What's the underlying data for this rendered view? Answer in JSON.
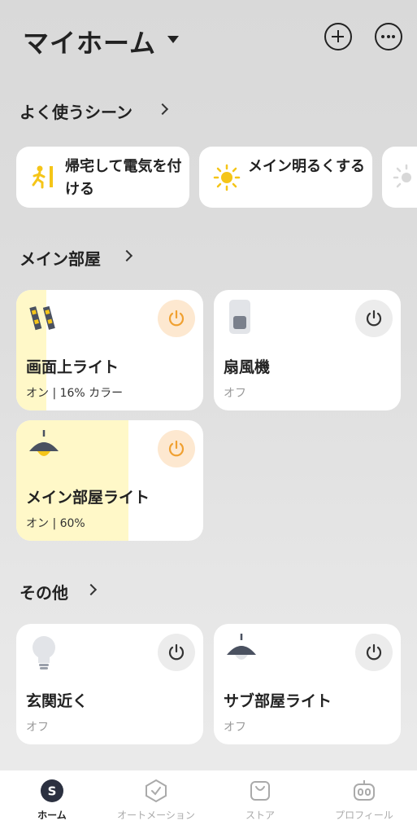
{
  "header": {
    "title": "マイホーム",
    "add_icon": "plus-circle-icon",
    "more_icon": "more-dots-icon"
  },
  "scenes_section": {
    "title": "よく使うシーン",
    "cards": [
      {
        "label": "帰宅して電気を付ける",
        "icon": "person-door-icon"
      },
      {
        "label": "メイン明るくする",
        "icon": "sun-icon"
      },
      {
        "label": "",
        "icon": "sun-icon"
      }
    ]
  },
  "main_room_section": {
    "title": "メイン部屋",
    "devices": [
      {
        "name": "画面上ライト",
        "status": "オン | 16% カラー",
        "power": "on",
        "level_percent": 16,
        "icon": "light-bar-icon"
      },
      {
        "name": "扇風機",
        "status": "オフ",
        "power": "off",
        "icon": "fan-switch-icon"
      },
      {
        "name": "メイン部屋ライト",
        "status": "オン | 60%",
        "power": "on",
        "level_percent": 60,
        "icon": "pendant-lamp-icon"
      }
    ]
  },
  "other_section": {
    "title": "その他",
    "devices": [
      {
        "name": "玄関近く",
        "status": "オフ",
        "power": "off",
        "icon": "bulb-icon"
      },
      {
        "name": "サブ部屋ライト",
        "status": "オフ",
        "power": "off",
        "icon": "pendant-lamp-icon"
      }
    ]
  },
  "tabbar": {
    "tabs": [
      {
        "label": "ホーム",
        "active": true,
        "icon": "home-s-icon"
      },
      {
        "label": "オートメーション",
        "active": false,
        "icon": "shield-check-icon"
      },
      {
        "label": "ストア",
        "active": false,
        "icon": "bag-icon"
      },
      {
        "label": "プロフィール",
        "active": false,
        "icon": "robot-face-icon"
      }
    ]
  },
  "colors": {
    "on_fill": "#fff8c8",
    "power_on": "#f0a030",
    "power_on_bg": "#fde8d0",
    "icon_gray": "#4a5160"
  }
}
